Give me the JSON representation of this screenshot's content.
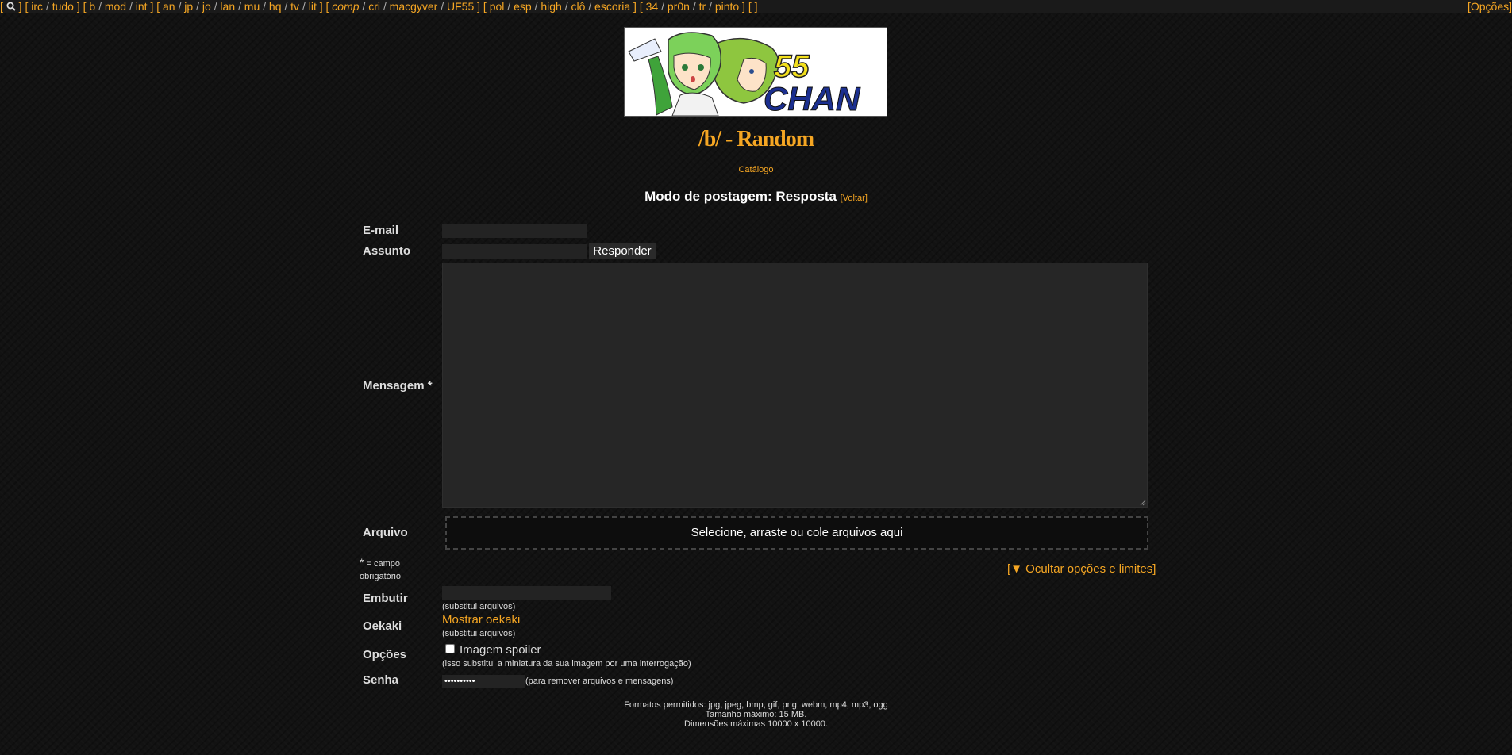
{
  "topbar": {
    "groups": [
      [
        "irc",
        "tudo"
      ],
      [
        "b",
        "mod",
        "int"
      ],
      [
        "an",
        "jp",
        "jo",
        "lan",
        "mu",
        "hq",
        "tv",
        "lit"
      ],
      [
        "comp",
        "cri",
        "macgyver",
        "UF55"
      ],
      [
        "pol",
        "esp",
        "high",
        "clô",
        "escoria"
      ],
      [
        "34",
        "pr0n",
        "tr",
        "pinto"
      ],
      []
    ],
    "options_label": "[Opções]"
  },
  "board": {
    "title": "/b/ - Random",
    "catalog_link": "Catálogo"
  },
  "posting": {
    "mode": "Modo de postagem: Resposta",
    "back_link": "[Voltar]"
  },
  "form": {
    "email_label": "E-mail",
    "subject_label": "Assunto",
    "submit_label": "Responder",
    "message_label": "Mensagem *",
    "file_label": "Arquivo",
    "dropzone_text": "Selecione, arraste ou cole arquivos aqui",
    "required_note_star": "*",
    "required_note_text": "= campo",
    "required_note_text2": "obrigatório",
    "toggle_options": "[▼ Ocultar opções e limites]",
    "embed_label": "Embutir",
    "embed_note": "(substitui arquivos)",
    "oekaki_label": "Oekaki",
    "oekaki_link": "Mostrar oekaki",
    "oekaki_note": "(substitui arquivos)",
    "options_label": "Opções",
    "spoiler_label": "Imagem spoiler",
    "spoiler_note": "(isso substitui a miniatura da sua imagem por uma interrogação)",
    "password_label": "Senha",
    "password_value": "••••••••••",
    "password_note": "(para remover arquivos e mensagens)"
  },
  "footer": {
    "formats": "Formatos permitidos: jpg, jpeg, bmp, gif, png, webm, mp4, mp3, ogg",
    "max_size": "Tamanho máximo: 15 MB.",
    "max_dims": "Dimensões máximas 10000 x 10000."
  },
  "banner": {
    "text_55": "55",
    "text_chan": "CHAN"
  },
  "colors": {
    "accent": "#f5a623",
    "background": "#121212"
  }
}
